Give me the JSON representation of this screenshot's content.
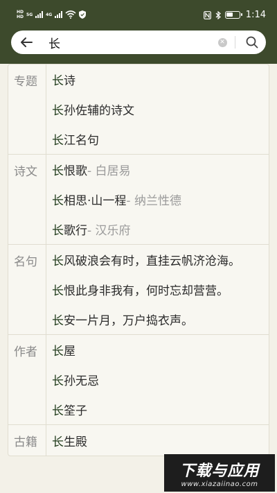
{
  "status_bar": {
    "hd_top": "HD",
    "hd_bottom": "HD",
    "net_5g": "5G",
    "net_4g": "4G",
    "time": "1:14"
  },
  "search": {
    "query": "长"
  },
  "groups": [
    {
      "category": "专题",
      "items": [
        {
          "keyword": "长",
          "text": "诗",
          "sub": ""
        },
        {
          "keyword": "长",
          "text": "孙佐辅的诗文",
          "sub": ""
        },
        {
          "keyword": "长",
          "text": "江名句",
          "sub": ""
        }
      ]
    },
    {
      "category": "诗文",
      "items": [
        {
          "keyword": "长",
          "text": "恨歌",
          "sub": " - 白居易"
        },
        {
          "keyword": "长",
          "text": "相思·山一程",
          "sub": " - 纳兰性德"
        },
        {
          "keyword": "长",
          "text": "歌行",
          "sub": " - 汉乐府"
        }
      ]
    },
    {
      "category": "名句",
      "items": [
        {
          "keyword": "长",
          "text": "风破浪会有时，直挂云帆济沧海。",
          "sub": ""
        },
        {
          "keyword": "长",
          "text": "恨此身非我有，何时忘却营营。",
          "sub": ""
        },
        {
          "keyword": "长",
          "text": "安一片月，万户捣衣声。",
          "sub": ""
        }
      ]
    },
    {
      "category": "作者",
      "items": [
        {
          "keyword": "长",
          "text": "屋",
          "sub": ""
        },
        {
          "keyword": "长",
          "text": "孙无忌",
          "sub": ""
        },
        {
          "keyword": "长",
          "text": "筌子",
          "sub": ""
        }
      ]
    },
    {
      "category": "古籍",
      "items": [
        {
          "keyword": "长",
          "text": "生殿",
          "sub": ""
        }
      ]
    }
  ],
  "watermark": {
    "main": "下载与应用",
    "sub": "www.xiazaiinao.com"
  }
}
